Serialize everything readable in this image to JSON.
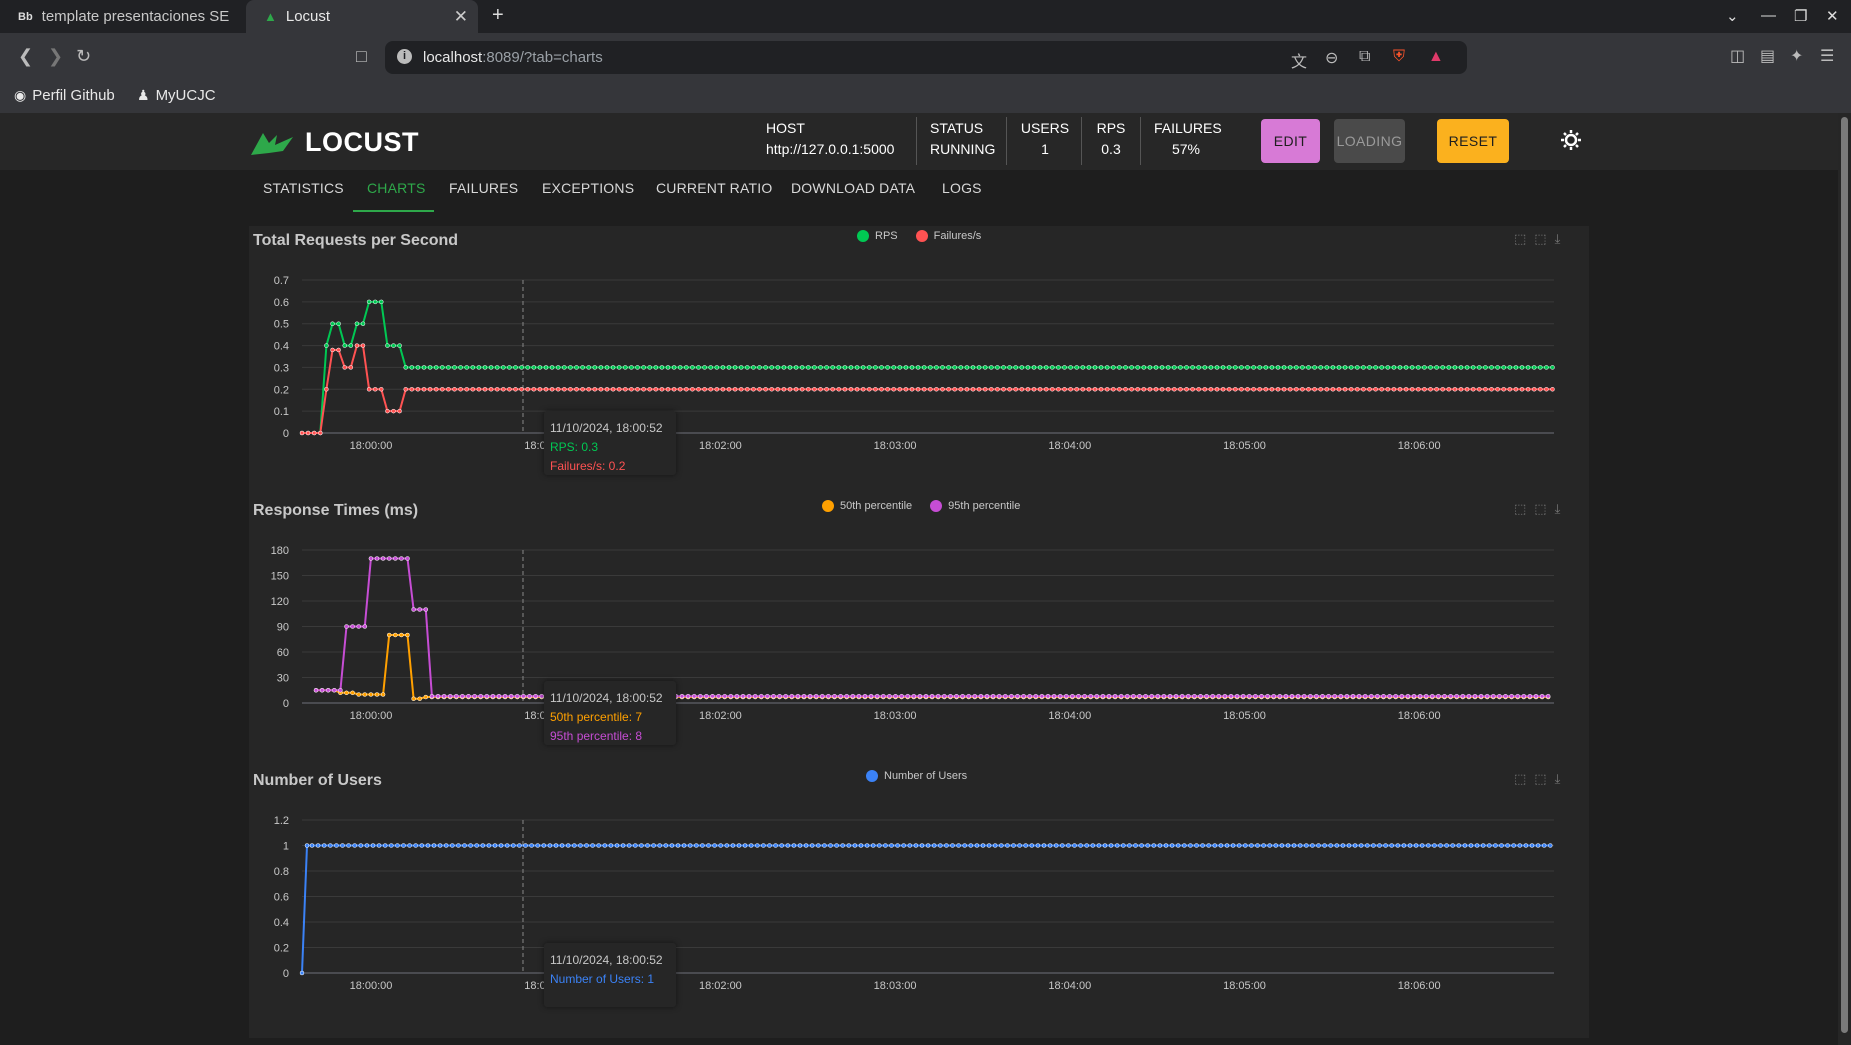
{
  "browser": {
    "tabs": [
      {
        "favicon": "Bb",
        "title": "template presentaciones SE"
      },
      {
        "favicon": "locust-logo-icon",
        "title": "Locust"
      }
    ],
    "url_host": "localhost",
    "url_path": ":8089/?tab=charts",
    "bookmarks": [
      {
        "icon": "github-icon",
        "label": "Perfil Github"
      },
      {
        "icon": "person-icon",
        "label": "MyUCJC"
      }
    ]
  },
  "app": {
    "logo_text": "LOCUST",
    "stats": {
      "host_label": "HOST",
      "host_value": "http://127.0.0.1:5000",
      "status_label": "STATUS",
      "status_value": "RUNNING",
      "users_label": "USERS",
      "users_value": "1",
      "rps_label": "RPS",
      "rps_value": "0.3",
      "failures_label": "FAILURES",
      "failures_value": "57%"
    },
    "buttons": {
      "edit": "EDIT",
      "loading": "LOADING",
      "reset": "RESET"
    },
    "tabs": [
      "STATISTICS",
      "CHARTS",
      "FAILURES",
      "EXCEPTIONS",
      "CURRENT RATIO",
      "DOWNLOAD DATA",
      "LOGS"
    ],
    "active_tab": "CHARTS",
    "accent_color": "#2ea84a"
  },
  "chart_data": [
    {
      "type": "line",
      "title": "Total Requests per Second",
      "x_ticks": [
        "18:00:00",
        "18:01:00",
        "18:02:00",
        "18:03:00",
        "18:04:00",
        "18:05:00",
        "18:06:00"
      ],
      "ylim": [
        0,
        0.7
      ],
      "y_ticks": [
        "0",
        "0.1",
        "0.2",
        "0.3",
        "0.4",
        "0.5",
        "0.6",
        "0.7"
      ],
      "series": [
        {
          "name": "RPS",
          "color": "#00c853",
          "values": [
            0,
            0,
            0,
            0,
            0.4,
            0.5,
            0.5,
            0.4,
            0.4,
            0.5,
            0.5,
            0.6,
            0.6,
            0.6,
            0.4,
            0.4,
            0.4,
            0.3
          ],
          "tail_value": 0.3
        },
        {
          "name": "Failures/s",
          "color": "#ff5252",
          "values": [
            0,
            0,
            0,
            0,
            0.2,
            0.38,
            0.38,
            0.3,
            0.3,
            0.4,
            0.4,
            0.2,
            0.2,
            0.2,
            0.1,
            0.1,
            0.1,
            0.2
          ],
          "tail_value": 0.2
        }
      ],
      "tooltip": {
        "time": "11/10/2024, 18:00:52",
        "lines": [
          "RPS: 0.3",
          "Failures/s: 0.2"
        ]
      }
    },
    {
      "type": "line",
      "title": "Response Times (ms)",
      "x_ticks": [
        "18:00:00",
        "18:01:00",
        "18:02:00",
        "18:03:00",
        "18:04:00",
        "18:05:00",
        "18:06:00"
      ],
      "ylim": [
        0,
        180
      ],
      "y_ticks": [
        "0",
        "30",
        "60",
        "90",
        "120",
        "150",
        "180"
      ],
      "series": [
        {
          "name": "50th percentile",
          "color": "#ffa000",
          "values": [
            15,
            15,
            15,
            15,
            12,
            12,
            12,
            10,
            10,
            10,
            10,
            10,
            80,
            80,
            80,
            80,
            5,
            5,
            7
          ],
          "tail_value": 7
        },
        {
          "name": "95th percentile",
          "color": "#c64dd4",
          "values": [
            15,
            15,
            15,
            15,
            15,
            90,
            90,
            90,
            90,
            170,
            170,
            170,
            170,
            170,
            170,
            170,
            110,
            110,
            110,
            8
          ],
          "tail_value": 8
        }
      ],
      "tooltip": {
        "time": "11/10/2024, 18:00:52",
        "lines": [
          "50th percentile: 7",
          "95th percentile: 8"
        ]
      }
    },
    {
      "type": "line",
      "title": "Number of Users",
      "x_ticks": [
        "18:00:00",
        "18:01:00",
        "18:02:00",
        "18:03:00",
        "18:04:00",
        "18:05:00",
        "18:06:00"
      ],
      "ylim": [
        0,
        1.2
      ],
      "y_ticks": [
        "0",
        "0.2",
        "0.4",
        "0.6",
        "0.8",
        "1",
        "1.2"
      ],
      "series": [
        {
          "name": "Number of Users",
          "color": "#3b82f6",
          "values": [
            0,
            1
          ],
          "tail_value": 1
        }
      ],
      "tooltip": {
        "time": "11/10/2024, 18:00:52",
        "lines": [
          "Number of Users: 1"
        ]
      }
    }
  ]
}
